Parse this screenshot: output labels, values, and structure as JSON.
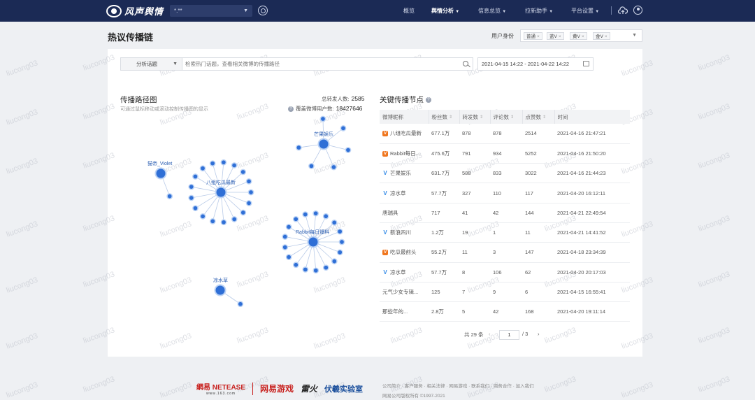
{
  "app": {
    "logo_text": "风声舆情",
    "project_select": "*.**",
    "nav": [
      {
        "label": "概览",
        "caret": false,
        "active": false
      },
      {
        "label": "舆情分析",
        "caret": true,
        "active": true
      },
      {
        "label": "信息总览",
        "caret": true,
        "active": false
      },
      {
        "label": "拉新助手",
        "caret": true,
        "active": false
      },
      {
        "label": "平台设置",
        "caret": true,
        "active": false
      }
    ]
  },
  "header": {
    "title": "热议传播链",
    "filter_label": "用户身份",
    "tags": [
      "普通",
      "蓝V",
      "黄V",
      "金V"
    ]
  },
  "search": {
    "type_label": "分析话题",
    "placeholder": "检索热门话题，查看相关微博的传播路径",
    "date_range": "2021-04-15 14:22 - 2021-04-22 14:22"
  },
  "graph": {
    "title": "传播路径图",
    "subtitle": "可通过鼠标移动或滚动控制传播图的显示",
    "total_reposters_label": "总转发人数:",
    "total_reposters": "2585",
    "coverage_label": "覆盖微博用户数:",
    "coverage": "18427646",
    "clusters": [
      {
        "label": "芒果娱乐",
        "leaves": 6
      },
      {
        "label": "猫帝_Violet",
        "leaves": 1
      },
      {
        "label": "八组吃瓜最新",
        "leaves": 17
      },
      {
        "label": "Rabbit每日爆料",
        "leaves": 17
      },
      {
        "label": "凉水草",
        "leaves": 1
      }
    ]
  },
  "table": {
    "title": "关键传播节点",
    "columns": [
      "微博昵称",
      "粉丝数",
      "转发数",
      "评论数",
      "点赞数",
      "时间"
    ],
    "rows": [
      {
        "badge": "V",
        "badge_color": "orange",
        "name": "八组吃瓜最新",
        "fans": "677.1万",
        "reposts": "878",
        "comments": "878",
        "likes": "2514",
        "time": "2021-04-16 21:47:21"
      },
      {
        "badge": "V",
        "badge_color": "orange",
        "name": "Rabbit每日...",
        "fans": "475.6万",
        "reposts": "791",
        "comments": "934",
        "likes": "5252",
        "time": "2021-04-16 21:50:20"
      },
      {
        "badge": "V",
        "badge_color": "blue",
        "name": "芒果娱乐",
        "fans": "631.7万",
        "reposts": "588",
        "comments": "833",
        "likes": "3022",
        "time": "2021-04-16 21:44:23"
      },
      {
        "badge": "V",
        "badge_color": "blue",
        "name": "凉水草",
        "fans": "57.7万",
        "reposts": "327",
        "comments": "110",
        "likes": "117",
        "time": "2021-04-20 16:12:11"
      },
      {
        "badge": "",
        "badge_color": "none",
        "name": "唐瑞具",
        "fans": "717",
        "reposts": "41",
        "comments": "42",
        "likes": "144",
        "time": "2021-04-21 22:49:54"
      },
      {
        "badge": "V",
        "badge_color": "blue",
        "name": "新浪四川",
        "fans": "1.2万",
        "reposts": "19",
        "comments": "1",
        "likes": "11",
        "time": "2021-04-21 14:41:52"
      },
      {
        "badge": "V",
        "badge_color": "orange",
        "name": "吃瓜最前头",
        "fans": "55.2万",
        "reposts": "11",
        "comments": "3",
        "likes": "147",
        "time": "2021-04-18 23:34:39"
      },
      {
        "badge": "V",
        "badge_color": "blue",
        "name": "凉水草",
        "fans": "57.7万",
        "reposts": "8",
        "comments": "106",
        "likes": "62",
        "time": "2021-04-20 20:17:03"
      },
      {
        "badge": "",
        "badge_color": "none",
        "name": "元气少女专辑...",
        "fans": "125",
        "reposts": "7",
        "comments": "9",
        "likes": "6",
        "time": "2021-04-15 16:55:41"
      },
      {
        "badge": "",
        "badge_color": "none",
        "name": "那些年的...",
        "fans": "2.8万",
        "reposts": "5",
        "comments": "42",
        "likes": "168",
        "time": "2021-04-20 19:11:14"
      }
    ]
  },
  "pagination": {
    "total_text": "共 29 条",
    "current": "1",
    "total_pages_text": "/ 3"
  },
  "watermark": "liucong03",
  "footer": {
    "logo_netease": "網易 NETEASE",
    "logo_163": "www.163.com",
    "logo_games": "网易游戏",
    "logo_third": "雷火",
    "logo_lab": "伏羲实验室",
    "links": "公司简介 · 客户服务 · 相关法律 · 网易游戏 · 联系我们 · 商务合作 · 加入我们",
    "copyright": "网易公司版权所有 ©1997-2021"
  },
  "colors": {
    "nav_bg": "#1b2a55",
    "node_blue": "#2f6fd6",
    "badge_orange": "#f0761e",
    "badge_blue": "#2f88e6"
  }
}
